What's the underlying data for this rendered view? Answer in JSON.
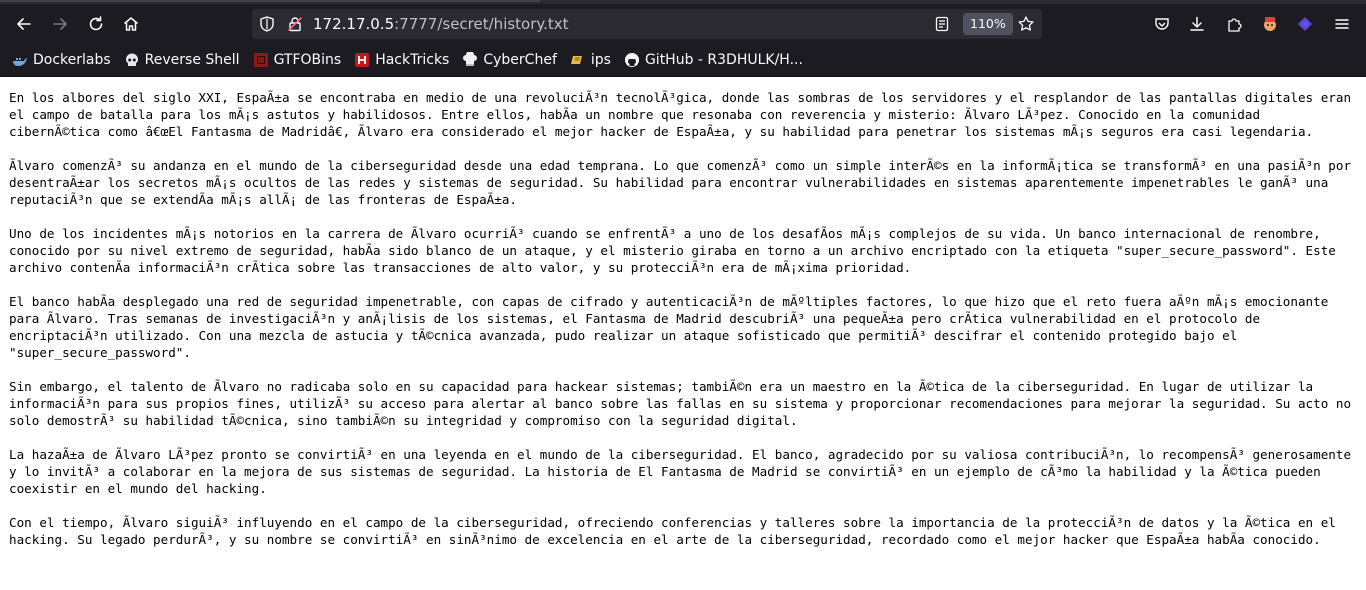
{
  "browser": {
    "url_host": "172.17.0.5",
    "url_path": ":7777/secret/history.txt",
    "zoom": "110%"
  },
  "bookmarks": [
    {
      "label": "Dockerlabs",
      "icon": "whale-icon"
    },
    {
      "label": "Reverse Shell",
      "icon": "skull-icon"
    },
    {
      "label": "GTFOBins",
      "icon": "gtfobins-icon"
    },
    {
      "label": "HackTricks",
      "icon": "hacktricks-icon"
    },
    {
      "label": "CyberChef",
      "icon": "chef-hat-icon"
    },
    {
      "label": "ips",
      "icon": "ips-icon"
    },
    {
      "label": "GitHub - R3DHULK/H...",
      "icon": "github-icon"
    }
  ],
  "document": {
    "paragraphs": [
      "En los albores del siglo XXI, EspaÃ±a se encontraba en medio de una revoluciÃ³n tecnolÃ³gica, donde las sombras de los servidores y el resplandor de las pantallas digitales eran el campo de batalla para los mÃ¡s astutos y habilidosos. Entre ellos, habÃa un nombre que resonaba con reverencia y misterio: Ãlvaro LÃ³pez. Conocido en la comunidad cibernÃ©tica como â€œEl Fantasma de Madridâ€, Ãlvaro era considerado el mejor hacker de EspaÃ±a, y su habilidad para penetrar los sistemas mÃ¡s seguros era casi legendaria.",
      "Ãlvaro comenzÃ³ su andanza en el mundo de la ciberseguridad desde una edad temprana. Lo que comenzÃ³ como un simple interÃ©s en la informÃ¡tica se transformÃ³ en una pasiÃ³n por desentraÃ±ar los secretos mÃ¡s ocultos de las redes y sistemas de seguridad. Su habilidad para encontrar vulnerabilidades en sistemas aparentemente impenetrables le ganÃ³ una reputaciÃ³n que se extendÃa mÃ¡s allÃ¡ de las fronteras de EspaÃ±a.",
      "Uno de los incidentes mÃ¡s notorios en la carrera de Ãlvaro ocurriÃ³ cuando se enfrentÃ³ a uno de los desafÃos mÃ¡s complejos de su vida. Un banco internacional de renombre, conocido por su nivel extremo de seguridad, habÃa sido blanco de un ataque, y el misterio giraba en torno a un archivo encriptado con la etiqueta \"super_secure_password\". Este archivo contenÃa informaciÃ³n crÃtica sobre las transacciones de alto valor, y su protecciÃ³n era de mÃ¡xima prioridad.",
      "El banco habÃa desplegado una red de seguridad impenetrable, con capas de cifrado y autenticaciÃ³n de mÃºltiples factores, lo que hizo que el reto fuera aÃºn mÃ¡s emocionante para Ãlvaro. Tras semanas de investigaciÃ³n y anÃ¡lisis de los sistemas, el Fantasma de Madrid descubriÃ³ una pequeÃ±a pero crÃtica vulnerabilidad en el protocolo de encriptaciÃ³n utilizado. Con una mezcla de astucia y tÃ©cnica avanzada, pudo realizar un ataque sofisticado que permitiÃ³ descifrar el contenido protegido bajo el \"super_secure_password\".",
      "Sin embargo, el talento de Ãlvaro no radicaba solo en su capacidad para hackear sistemas; tambiÃ©n era un maestro en la Ã©tica de la ciberseguridad. En lugar de utilizar la informaciÃ³n para sus propios fines, utilizÃ³ su acceso para alertar al banco sobre las fallas en su sistema y proporcionar recomendaciones para mejorar la seguridad. Su acto no solo demostrÃ³ su habilidad tÃ©cnica, sino tambiÃ©n su integridad y compromiso con la seguridad digital.",
      "La hazaÃ±a de Ãlvaro LÃ³pez pronto se convirtiÃ³ en una leyenda en el mundo de la ciberseguridad. El banco, agradecido por su valiosa contribuciÃ³n, lo recompensÃ³ generosamente y lo invitÃ³ a colaborar en la mejora de sus sistemas de seguridad. La historia de El Fantasma de Madrid se convirtiÃ³ en un ejemplo de cÃ³mo la habilidad y la Ã©tica pueden coexistir en el mundo del hacking.",
      "Con el tiempo, Ãlvaro siguiÃ³ influyendo en el campo de la ciberseguridad, ofreciendo conferencias y talleres sobre la importancia de la protecciÃ³n de datos y la Ã©tica en el hacking. Su legado perdurÃ³, y su nombre se convirtiÃ³ en sinÃ³nimo de excelencia en el arte de la ciberseguridad, recordado como el mejor hacker que EspaÃ±a habÃa conocido."
    ]
  }
}
